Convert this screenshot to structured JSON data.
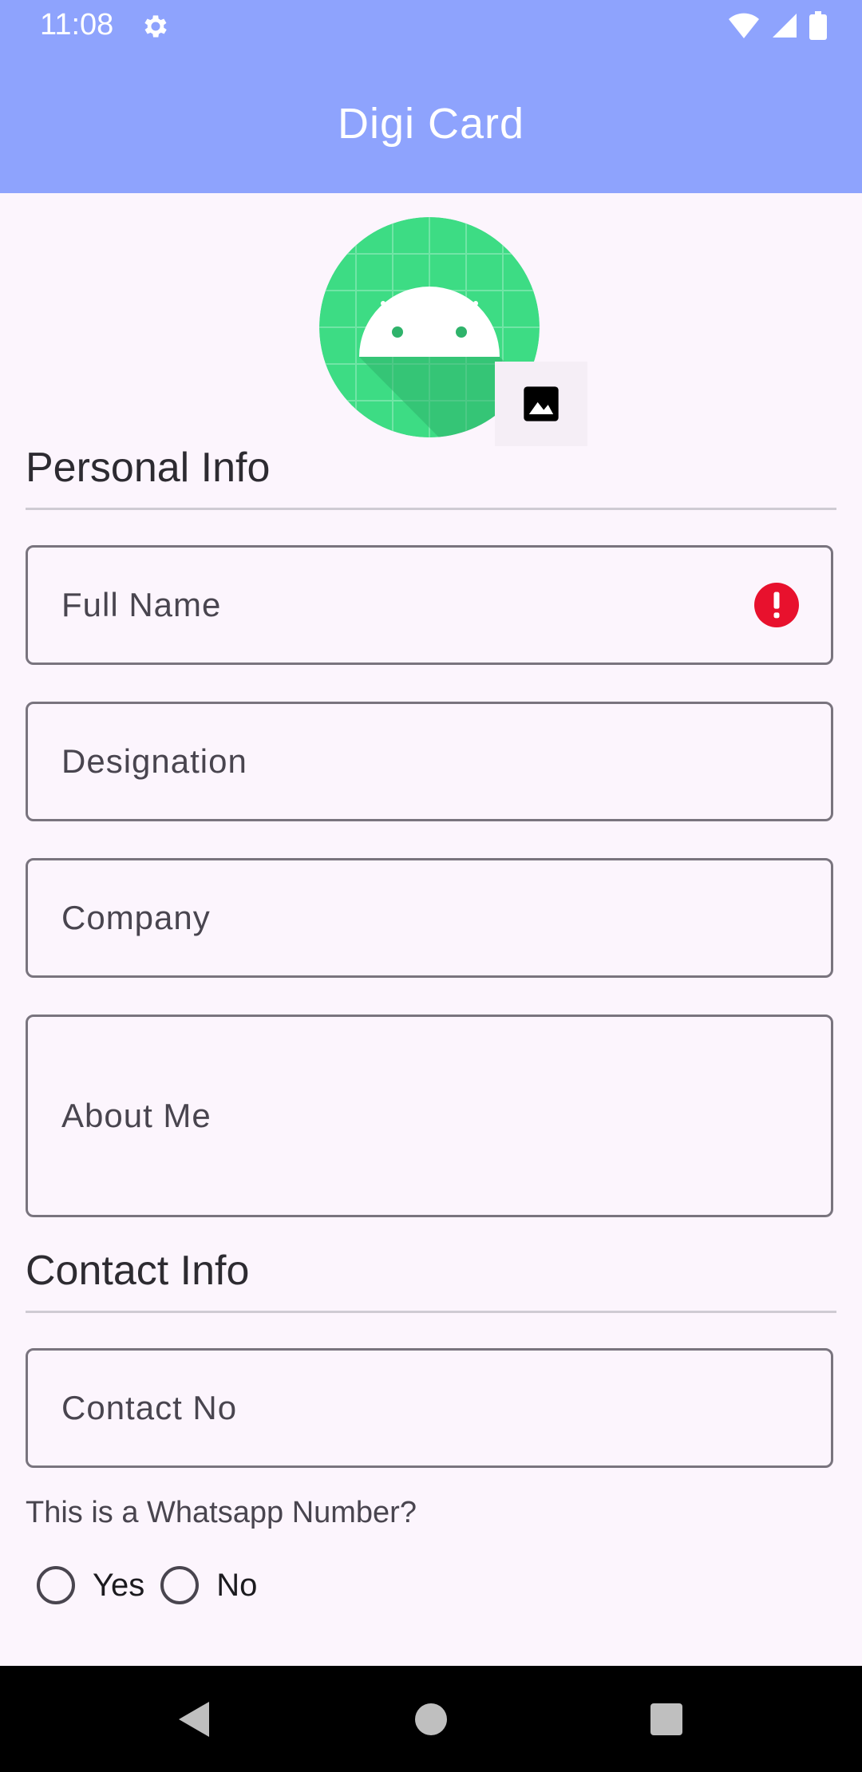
{
  "status_bar": {
    "time": "11:08",
    "icons": [
      "gear-icon",
      "wifi-icon",
      "signal-icon",
      "battery-icon"
    ]
  },
  "app_bar": {
    "title": "Digi Card",
    "color": "#8ea3fd"
  },
  "profile": {
    "avatar": "android-logo",
    "pick_icon": "image-icon"
  },
  "personal_info": {
    "title": "Personal Info",
    "fields": {
      "full_name": {
        "placeholder": "Full Name",
        "value": "",
        "error": true
      },
      "designation": {
        "placeholder": "Designation",
        "value": ""
      },
      "company": {
        "placeholder": "Company",
        "value": ""
      },
      "about_me": {
        "placeholder": "About Me",
        "value": ""
      }
    }
  },
  "contact_info": {
    "title": "Contact Info",
    "fields": {
      "contact_no": {
        "placeholder": "Contact No",
        "value": ""
      }
    },
    "whatsapp_question": "This is a Whatsapp Number?",
    "options": {
      "yes": "Yes",
      "no": "No"
    },
    "selected": null
  },
  "colors": {
    "error": "#e8112d",
    "background": "#fcf5fd",
    "outline": "#79747e",
    "avatar_green": "#3ddc84"
  },
  "nav_bar": {
    "buttons": [
      "back-icon",
      "home-icon",
      "recents-icon"
    ]
  }
}
